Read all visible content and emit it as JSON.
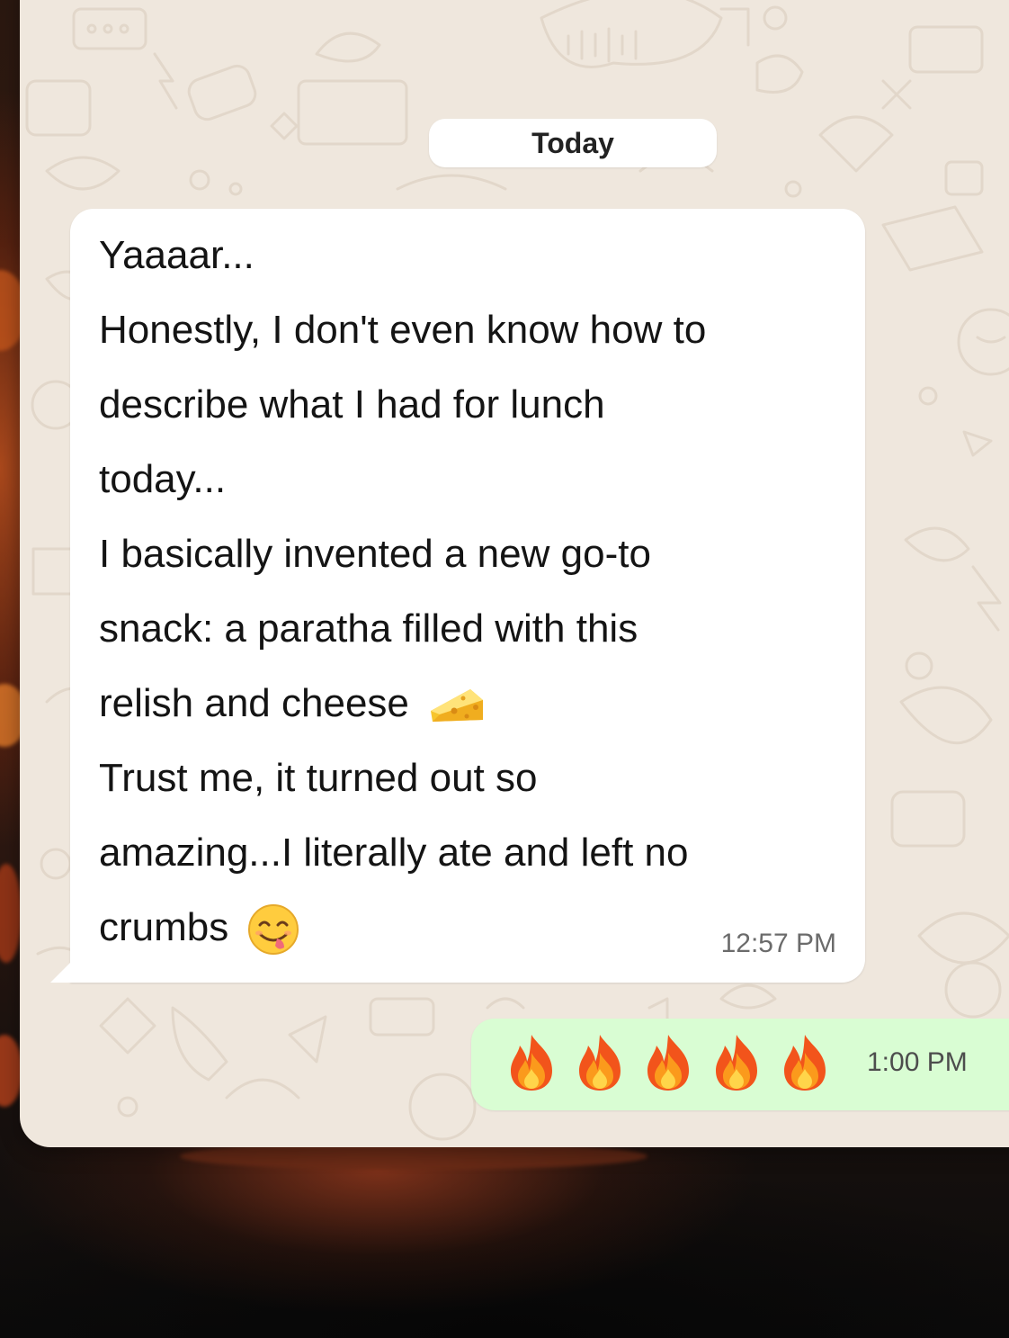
{
  "chat": {
    "date_separator": "Today",
    "incoming_message": {
      "lines": [
        "Yaaaar...",
        "Honestly, I don't even know how to",
        "describe what I had for lunch",
        "today...",
        "I basically invented a new go-to",
        "snack: a paratha filled with this",
        "relish and cheese",
        "Trust me, it turned out so",
        "amazing...I literally ate and left no",
        "crumbs"
      ],
      "inline_emojis": [
        "cheese-wedge-emoji",
        "face-savoring-food-emoji"
      ],
      "time": "12:57 PM"
    },
    "outgoing_message": {
      "emojis": [
        "fire-emoji",
        "fire-emoji",
        "fire-emoji",
        "fire-emoji",
        "fire-emoji"
      ],
      "time": "1:00 PM"
    }
  },
  "colors": {
    "chat_background": "#efe7dd",
    "incoming_bubble": "#ffffff",
    "outgoing_bubble": "#d9fdd3",
    "message_text": "#141414",
    "timestamp_text": "#6b6b6b"
  }
}
